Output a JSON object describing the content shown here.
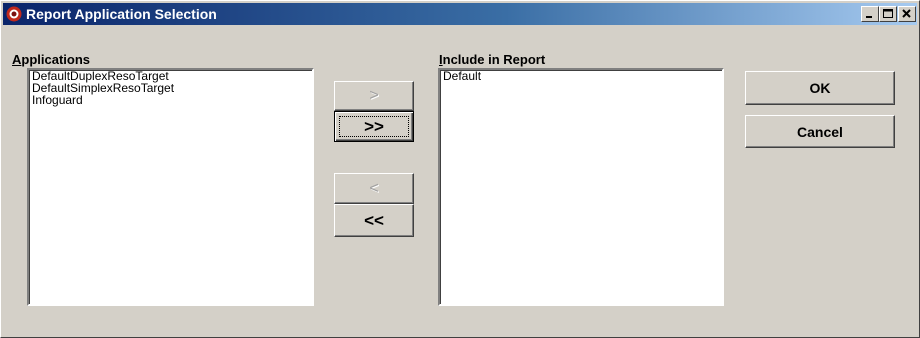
{
  "window": {
    "title": "Report Application Selection",
    "icon": "app-icon"
  },
  "applications": {
    "label_mnemonic": "A",
    "label_rest": "pplications",
    "items": [
      "DefaultDuplexResoTarget",
      "DefaultSimplexResoTarget",
      "Infoguard"
    ]
  },
  "include": {
    "label_mnemonic": "I",
    "label_rest": "nclude in Report",
    "items": [
      "Default"
    ]
  },
  "buttons": {
    "add_one": ">",
    "add_all": ">>",
    "remove_one": "<",
    "remove_all": "<<",
    "ok": "OK",
    "cancel": "Cancel"
  }
}
